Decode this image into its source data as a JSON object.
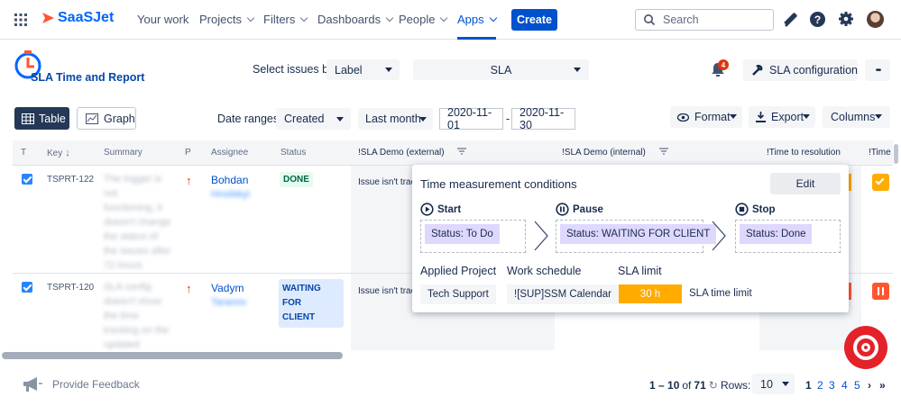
{
  "nav": {
    "logo": "SaaSJet",
    "items": [
      "Your work",
      "Projects",
      "Filters",
      "Dashboards",
      "People",
      "Apps"
    ],
    "create": "Create",
    "search_placeholder": "Search"
  },
  "app": {
    "title": "SLA Time and Report",
    "select_by_label": "Select issues by",
    "select_by_value": "Label",
    "sla_value": "SLA",
    "notif_count": "4",
    "sla_config": "SLA configuration",
    "more": "•••"
  },
  "toolbar": {
    "table": "Table",
    "graph": "Graph",
    "date_ranges": "Date ranges:",
    "created": "Created",
    "last_month": "Last month",
    "date_from": "2020-11-01",
    "dash": "-",
    "date_to": "2020-11-30",
    "format": "Format",
    "export": "Export",
    "columns": "Columns"
  },
  "table": {
    "headers": {
      "t": "T",
      "key": "Key",
      "summary": "Summary",
      "p": "P",
      "assignee": "Assignee",
      "status": "Status",
      "sla_ext": "!SLA Demo (external)",
      "sla_int": "!SLA Demo (internal)",
      "ttr": "!Time to resolution",
      "time": "!Time"
    },
    "rows": [
      {
        "key": "TSPRT-122",
        "summary": [
          "The trigger is",
          "not",
          "functioning, it",
          "doesn't change",
          "the status of",
          "the issues after",
          "72 hours"
        ],
        "assignee_first": "Bohdan",
        "assignee_last": "Hrodskyi",
        "status": "DONE",
        "sla_ext": "Issue isn't trac"
      },
      {
        "key": "TSPRT-120",
        "summary": [
          "SLA config",
          "doesn't show",
          "the time",
          "tracking on the",
          "updated"
        ],
        "assignee_first": "Vadym",
        "assignee_last": "Taranov",
        "status_l1": "WAITING FOR",
        "status_l2": "CLIENT",
        "sla_ext": "Issue isn't trac"
      }
    ]
  },
  "popup": {
    "title": "Time measurement conditions",
    "edit": "Edit",
    "start": "Start",
    "pause": "Pause",
    "stop": "Stop",
    "start_chip": "Status: To Do",
    "pause_chip": "Status: WAITING FOR CLIENT",
    "stop_chip": "Status: Done",
    "applied_project": "Applied Project",
    "work_schedule": "Work schedule",
    "sla_limit": "SLA limit",
    "project_value": "Tech Support",
    "schedule_value": "![SUP]SSM Calendar",
    "limit_value": "30 h",
    "limit_label": "SLA time limit"
  },
  "footer": {
    "feedback": "Provide Feedback",
    "range": "1 – 10",
    "of": "of",
    "total": "71",
    "rows_label": "Rows:",
    "rows_value": "10",
    "pages": [
      "1",
      "2",
      "3",
      "4",
      "5"
    ]
  },
  "colors": {
    "primary": "#0052cc",
    "done_bg": "#e3fcef",
    "done_fg": "#006644",
    "waiting_bg": "#deebff",
    "waiting_fg": "#0747a6",
    "chip": "#dfd8fd",
    "limit": "#ffab00",
    "red": "#de350b"
  }
}
